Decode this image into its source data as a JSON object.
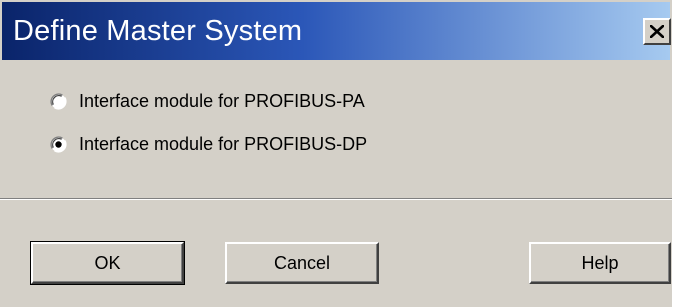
{
  "window": {
    "title": "Define Master System"
  },
  "options": [
    {
      "label": "Interface module for PROFIBUS-PA",
      "selected": false
    },
    {
      "label": "Interface module for PROFIBUS-DP",
      "selected": true
    }
  ],
  "buttons": {
    "ok": "OK",
    "cancel": "Cancel",
    "help": "Help"
  },
  "icons": {
    "close": "close-icon",
    "radio_unselected": "radio-unselected-icon",
    "radio_selected": "radio-selected-icon"
  },
  "colors": {
    "title_start": "#0a246a",
    "title_end": "#a6caf0",
    "dialog_bg": "#d4d0c8"
  }
}
